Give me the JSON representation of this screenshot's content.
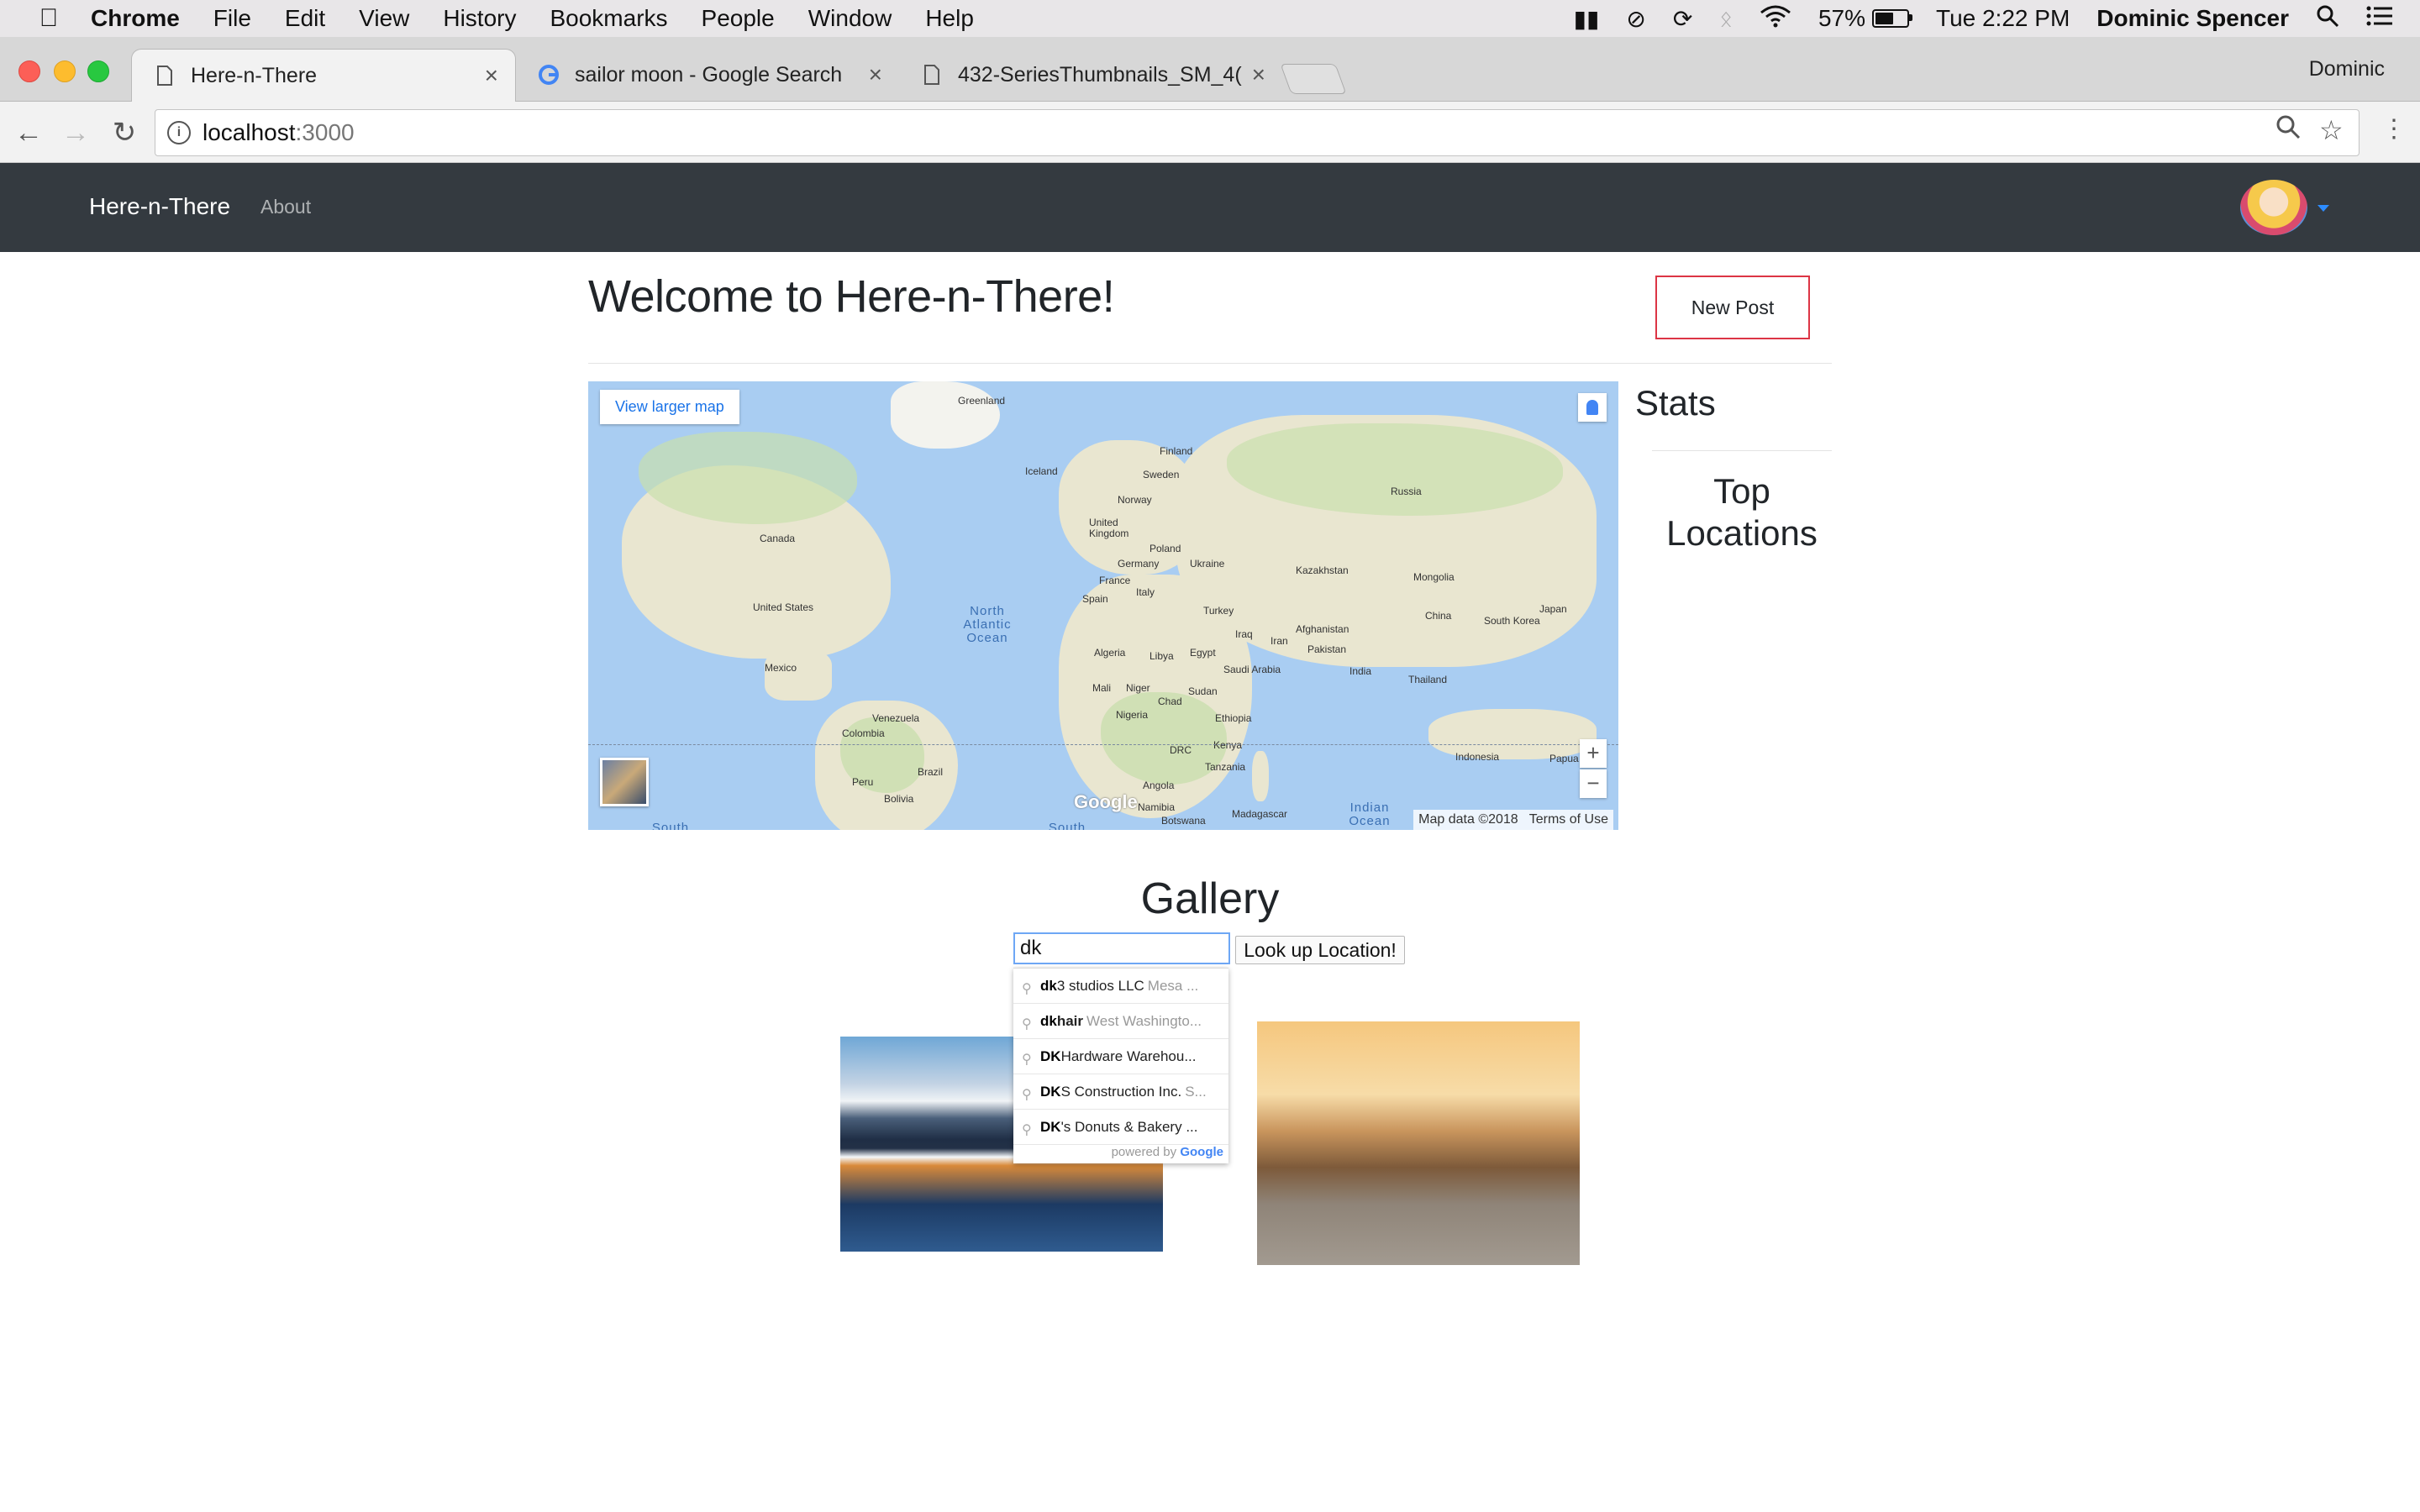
{
  "menubar": {
    "app_name": "Chrome",
    "items": [
      "File",
      "Edit",
      "View",
      "History",
      "Bookmarks",
      "People",
      "Window",
      "Help"
    ],
    "battery_percent": "57%",
    "battery_level": 0.57,
    "clock": "Tue 2:22 PM",
    "user": "Dominic Spencer"
  },
  "browser": {
    "tabs": [
      {
        "title": "Here-n-There",
        "active": true
      },
      {
        "title": "sailor moon - Google Search",
        "active": false
      },
      {
        "title": "432-SeriesThumbnails_SM_4(",
        "active": false
      }
    ],
    "profile": "Dominic",
    "url_host": "localhost",
    "url_port": ":3000"
  },
  "site": {
    "brand": "Here-n-There",
    "nav_about": "About",
    "welcome": "Welcome to Here-n-There!",
    "new_post": "New Post",
    "stats_heading": "Stats",
    "top_locations": "Top Locations",
    "gallery_heading": "Gallery",
    "search_value": "dk",
    "lookup_button": "Look up Location!"
  },
  "map": {
    "view_larger": "View larger map",
    "map_data": "Map data ©2018",
    "terms": "Terms of Use",
    "logo": "Google",
    "labels": {
      "greenland": "Greenland",
      "iceland": "Iceland",
      "finland": "Finland",
      "sweden": "Sweden",
      "norway": "Norway",
      "russia": "Russia",
      "uk": "United Kingdom",
      "poland": "Poland",
      "germany": "Germany",
      "ukraine": "Ukraine",
      "france": "France",
      "spain": "Spain",
      "italy": "Italy",
      "kazakhstan": "Kazakhstan",
      "mongolia": "Mongolia",
      "canada": "Canada",
      "us": "United States",
      "mexico": "Mexico",
      "turkey": "Turkey",
      "afghanistan": "Afghanistan",
      "china": "China",
      "south_korea": "South Korea",
      "japan": "Japan",
      "iraq": "Iraq",
      "iran": "Iran",
      "pakistan": "Pakistan",
      "algeria": "Algeria",
      "libya": "Libya",
      "egypt": "Egypt",
      "saudi": "Saudi Arabia",
      "india": "India",
      "thailand": "Thailand",
      "mali": "Mali",
      "niger": "Niger",
      "chad": "Chad",
      "sudan": "Sudan",
      "nigeria": "Nigeria",
      "ethiopia": "Ethiopia",
      "venezuela": "Venezuela",
      "colombia": "Colombia",
      "drc": "DRC",
      "kenya": "Kenya",
      "tanzania": "Tanzania",
      "indonesia": "Indonesia",
      "papua": "Papua",
      "peru": "Peru",
      "brazil": "Brazil",
      "bolivia": "Bolivia",
      "angola": "Angola",
      "namibia": "Namibia",
      "madagascar": "Madagascar",
      "botswana": "Botswana",
      "north_atlantic": "North Atlantic Ocean",
      "indian_ocean": "Indian Ocean",
      "south1": "South",
      "south2": "South"
    }
  },
  "autocomplete": {
    "items": [
      {
        "match": "dk",
        "rest": "3 studios LLC",
        "secondary": "Mesa ..."
      },
      {
        "match": "dk",
        "rest": " hair",
        "secondary": "West Washingto..."
      },
      {
        "match": "DK",
        "rest": " Hardware Warehou...",
        "secondary": ""
      },
      {
        "match": "DK",
        "rest": "S Construction Inc.",
        "secondary": "S..."
      },
      {
        "match": "DK",
        "rest": "'s Donuts & Bakery ...",
        "secondary": ""
      }
    ],
    "footer_prefix": "powered by",
    "footer_brand": "Google"
  },
  "colors": {
    "navbar": "#343a40",
    "new_post_border": "#dc3545",
    "link_blue": "#1a73e8"
  }
}
